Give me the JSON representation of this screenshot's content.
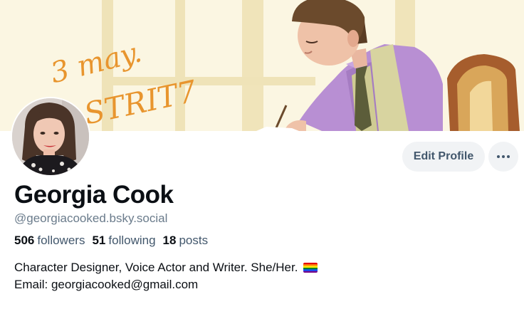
{
  "banner": {
    "script_text_line1": "3 may.",
    "script_text_line2": "STRIT7"
  },
  "actions": {
    "edit_profile_label": "Edit Profile",
    "more_label": "..."
  },
  "profile": {
    "display_name": "Georgia Cook",
    "handle": "@georgiacooked.bsky.social",
    "stats": {
      "followers_count": "506",
      "followers_label": "followers",
      "following_count": "51",
      "following_label": "following",
      "posts_count": "18",
      "posts_label": "posts"
    },
    "bio_line1": "Character Designer, Voice Actor and Writer. She/Her.",
    "bio_flag": "rainbow-pride-flag",
    "bio_line2": "Email: georgiacooked@gmail.com"
  },
  "colors": {
    "accent_button_bg": "#f1f3f5",
    "button_text": "#42576c",
    "handle_text": "#6a7b8b",
    "banner_script": "#e8952e"
  }
}
